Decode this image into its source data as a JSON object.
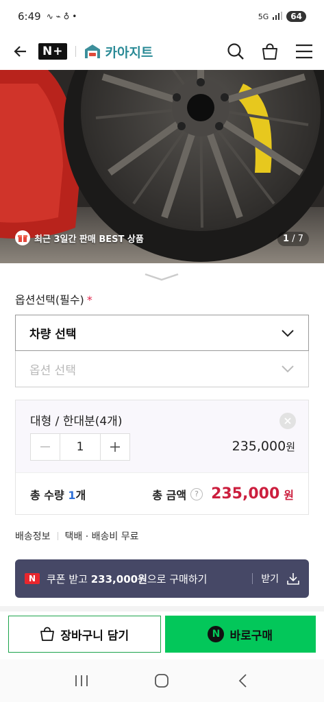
{
  "status_bar": {
    "time": "6:49",
    "network": "5G",
    "battery": "64"
  },
  "header": {
    "brand_badge": "N+",
    "store_name": "카아지트"
  },
  "hero": {
    "badge_text": "최근 3일간 판매 BEST 상품",
    "page_current": "1",
    "page_total": "/ 7"
  },
  "options": {
    "title": "옵션선택(필수)",
    "required_mark": "*",
    "vehicle_select": "차량 선택",
    "option_select": "옵션 선택"
  },
  "selected_item": {
    "name": "대형 / 한대분(4개)",
    "quantity": "1",
    "price": "235,000",
    "price_unit": "원"
  },
  "totals": {
    "qty_label": "총 수량",
    "qty_value": "1",
    "qty_unit": "개",
    "amount_label": "총 금액",
    "help": "?",
    "amount": "235,000",
    "amount_unit": "원"
  },
  "shipping": {
    "label": "배송정보",
    "value": "택배 · 배송비 무료"
  },
  "coupon": {
    "badge": "N",
    "text_prefix": "쿠폰 받고",
    "text_amount": "233,000원",
    "text_suffix": "으로 구매하기",
    "action": "받기"
  },
  "buttons": {
    "cart": "장바구니 담기",
    "buy_icon": "N",
    "buy": "바로구매"
  },
  "colors": {
    "accent_red": "#cc1f3e",
    "buy_green": "#03c75a",
    "coupon_bg": "#464866",
    "store_teal": "#2a8a96"
  }
}
